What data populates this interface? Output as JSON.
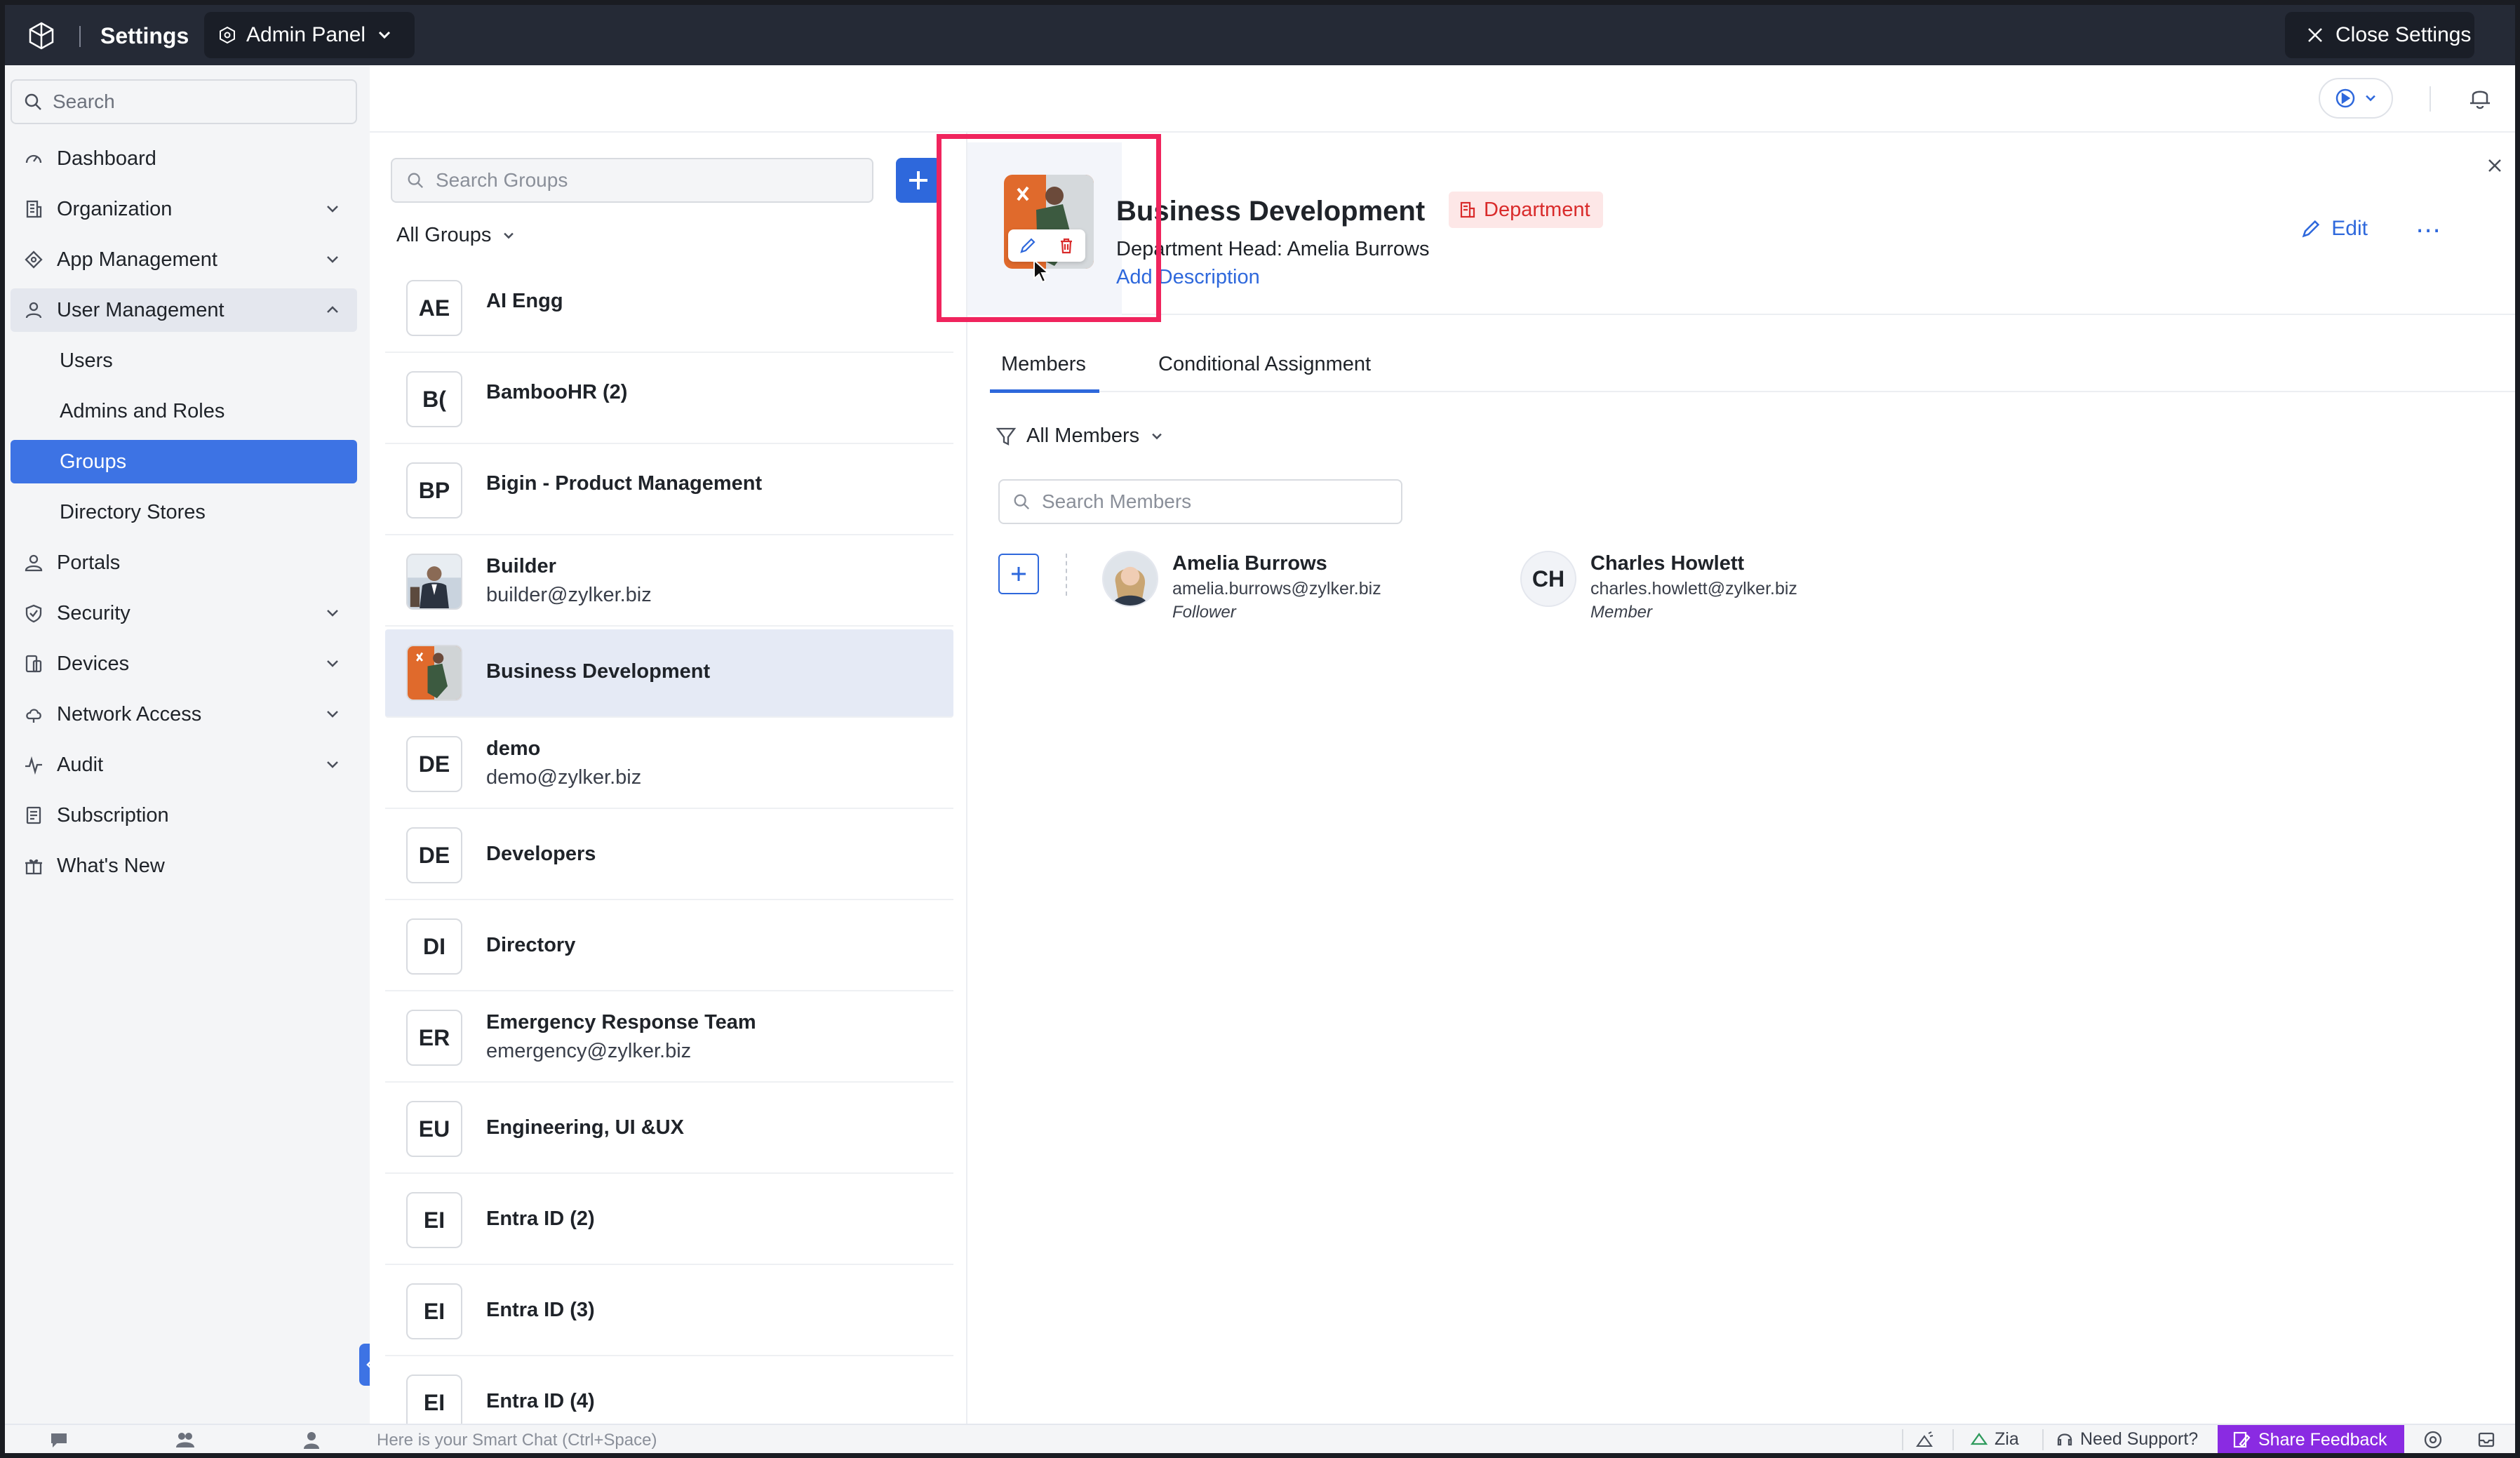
{
  "topbar": {
    "title": "Settings",
    "panel_label": "Admin Panel",
    "close_label": "Close Settings"
  },
  "sidebar": {
    "search_placeholder": "Search",
    "items": [
      {
        "label": "Dashboard",
        "icon": "dashboard-icon"
      },
      {
        "label": "Organization",
        "icon": "organization-icon"
      },
      {
        "label": "App Management",
        "icon": "app-management-icon"
      },
      {
        "label": "User Management",
        "icon": "user-icon"
      },
      {
        "label": "Users"
      },
      {
        "label": "Admins and Roles"
      },
      {
        "label": "Groups"
      },
      {
        "label": "Directory Stores"
      },
      {
        "label": "Portals",
        "icon": "portals-icon"
      },
      {
        "label": "Security",
        "icon": "shield-icon"
      },
      {
        "label": "Devices",
        "icon": "devices-icon"
      },
      {
        "label": "Network Access",
        "icon": "cloud-icon"
      },
      {
        "label": "Audit",
        "icon": "pulse-icon"
      },
      {
        "label": "Subscription",
        "icon": "receipt-icon"
      },
      {
        "label": "What's New",
        "icon": "gift-icon"
      }
    ]
  },
  "groups": {
    "search_placeholder": "Search Groups",
    "filter_label": "All Groups",
    "rows": [
      {
        "initials": "AE",
        "name": "AI Engg",
        "email": ""
      },
      {
        "initials": "B(",
        "name": "BambooHR (2)",
        "email": ""
      },
      {
        "initials": "BP",
        "name": "Bigin - Product Management",
        "email": ""
      },
      {
        "initials": "",
        "name": "Builder",
        "email": "builder@zylker.biz"
      },
      {
        "initials": "",
        "name": "Business Development",
        "email": ""
      },
      {
        "initials": "DE",
        "name": "demo",
        "email": "demo@zylker.biz"
      },
      {
        "initials": "DE",
        "name": "Developers",
        "email": ""
      },
      {
        "initials": "DI",
        "name": "Directory",
        "email": ""
      },
      {
        "initials": "ER",
        "name": "Emergency Response Team",
        "email": "emergency@zylker.biz"
      },
      {
        "initials": "EU",
        "name": "Engineering, UI &UX",
        "email": ""
      },
      {
        "initials": "EI",
        "name": "Entra ID (2)",
        "email": ""
      },
      {
        "initials": "EI",
        "name": "Entra ID (3)",
        "email": ""
      },
      {
        "initials": "EI",
        "name": "Entra ID (4)",
        "email": ""
      }
    ]
  },
  "detail": {
    "title": "Business Development",
    "badge": "Department",
    "head_label": "Department Head:",
    "head_name": "Amelia Burrows",
    "add_description": "Add Description",
    "edit_label": "Edit",
    "more_label": "⋯",
    "tabs": [
      "Members",
      "Conditional Assignment"
    ],
    "member_filter": "All Members",
    "member_search_placeholder": "Search Members",
    "members": [
      {
        "name": "Amelia Burrows",
        "email": "amelia.burrows@zylker.biz",
        "role": "Follower",
        "initials": ""
      },
      {
        "name": "Charles Howlett",
        "email": "charles.howlett@zylker.biz",
        "role": "Member",
        "initials": "CH"
      }
    ]
  },
  "bottombar": {
    "chat_placeholder": "Here is your Smart Chat (Ctrl+Space)",
    "zia": "Zia",
    "support": "Need Support?",
    "feedback": "Share Feedback"
  },
  "colors": {
    "accent": "#2e68dc",
    "sidebar_active": "#3d73e4",
    "highlight": "#f0245d",
    "badge_red": "#d92b2b",
    "topbar": "#252a36"
  }
}
